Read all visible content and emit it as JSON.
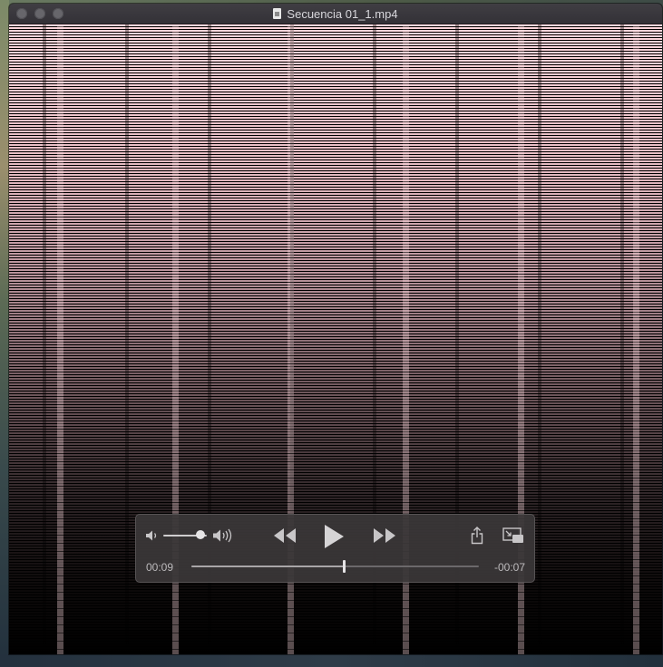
{
  "window": {
    "title": "Secuencia 01_1.mp4",
    "file_icon": "document-icon"
  },
  "player": {
    "elapsed": "00:09",
    "remaining": "-00:07",
    "progress": 0.53,
    "volume": 0.85,
    "icons": {
      "volume_low": "speaker-low-icon",
      "volume_high": "speaker-high-icon",
      "rewind": "rewind-icon",
      "play": "play-icon",
      "fast_forward": "fast-forward-icon",
      "share": "share-icon",
      "pip": "picture-in-picture-icon"
    }
  }
}
